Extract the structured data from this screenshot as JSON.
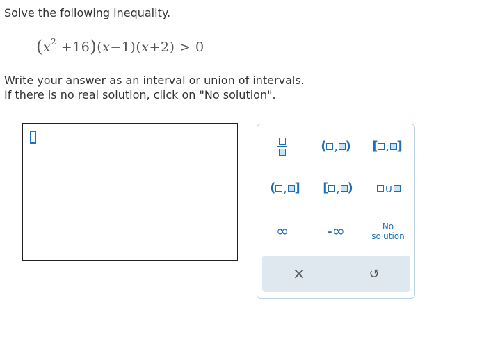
{
  "question": {
    "prompt": "Solve the following inequality.",
    "instructions_line1": "Write your answer as an interval or union of intervals.",
    "instructions_line2": "If there is no real solution, click on \"No solution\".",
    "equation": {
      "open1": "(",
      "x1": "x",
      "exp": "2",
      "plus16": "+16",
      "close1": ")",
      "open2": "(",
      "x2": "x",
      "minus1": "−1",
      "close2": ")",
      "open3": "(",
      "x3": "x",
      "plus2": "+2",
      "close3": ")",
      "rel": ">",
      "rhs": "0"
    }
  },
  "keypad": {
    "open_open": {
      "left": "(",
      "comma": ",",
      "right": ")"
    },
    "closed_closed": {
      "left": "[",
      "comma": ",",
      "right": "]"
    },
    "open_closed": {
      "left": "(",
      "comma": ",",
      "right": "]"
    },
    "closed_open": {
      "left": "[",
      "comma": ",",
      "right": ")"
    },
    "union": "∪",
    "infinity": "∞",
    "neg_infinity": "-∞",
    "no_solution_line1": "No",
    "no_solution_line2": "solution",
    "clear": "×",
    "undo": "↺"
  },
  "colors": {
    "accent": "#1f6fb2",
    "keypad_border": "#b9d3e0",
    "action_bar": "#dfe8ee",
    "cursor": "#1a6fd1"
  }
}
